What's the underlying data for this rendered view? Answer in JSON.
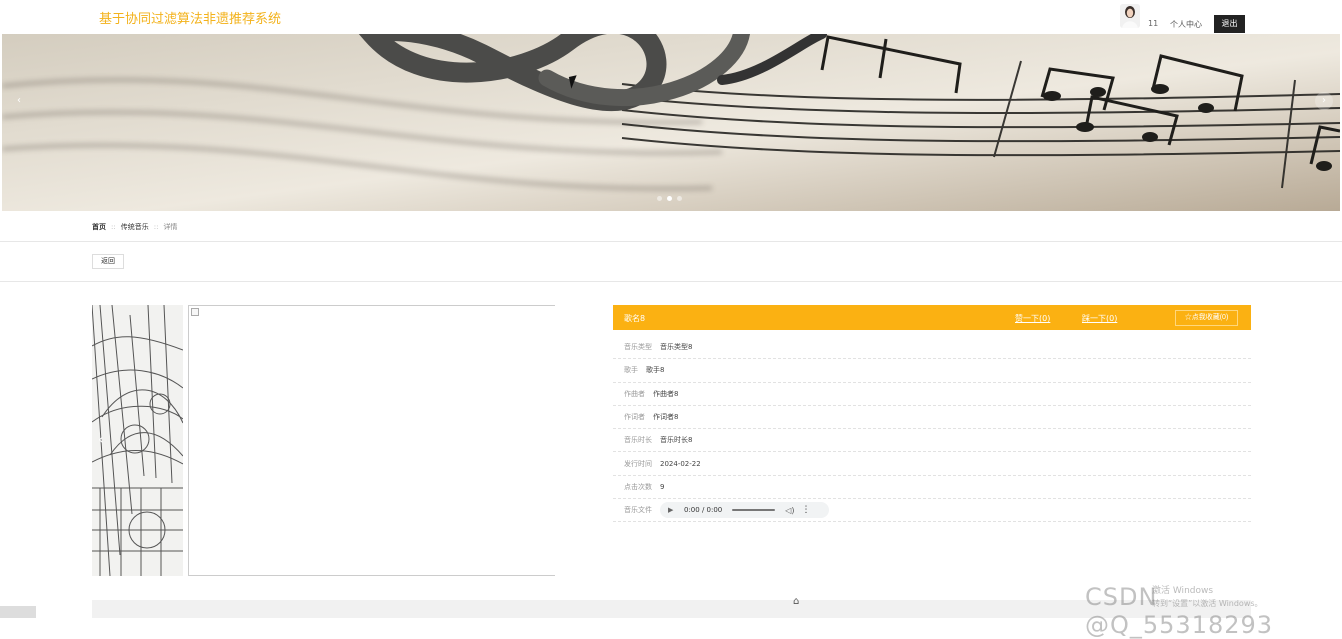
{
  "header": {
    "site_title": "基于协同过滤算法非遗推荐系统",
    "user_name": "11",
    "user_center": "个人中心",
    "logout": "退出"
  },
  "banner": {
    "prev": "‹",
    "next": "›",
    "active_slide": 2,
    "slide_count": 3
  },
  "breadcrumb": {
    "home": "首页",
    "category": "传统音乐",
    "current": "详情",
    "separator": "::"
  },
  "actions": {
    "back": "返回"
  },
  "gallery": {
    "thumb_prev": "‹"
  },
  "detail": {
    "song_name": "歌名8",
    "upvote": "赞一下(0)",
    "downvote": "踩一下(0)",
    "collect": "☆点我收藏(0)",
    "fields": [
      {
        "label": "音乐类型",
        "value": "音乐类型8"
      },
      {
        "label": "歌手",
        "value": "歌手8"
      },
      {
        "label": "作曲者",
        "value": "作曲者8"
      },
      {
        "label": "作词者",
        "value": "作词者8"
      },
      {
        "label": "音乐时长",
        "value": "音乐时长8"
      },
      {
        "label": "发行时间",
        "value": "2024-02-22"
      },
      {
        "label": "点击次数",
        "value": "9"
      }
    ],
    "audio_label": "音乐文件",
    "audio_time": "0:00 / 0:00"
  },
  "overlay": {
    "watermark": "CSDN @Q_55318293",
    "activation": "激活 Windows",
    "activation_hint": "转到“设置”以激活 Windows。"
  },
  "colors": {
    "brand": "#f3b21b",
    "detail_header": "#fbb112"
  }
}
